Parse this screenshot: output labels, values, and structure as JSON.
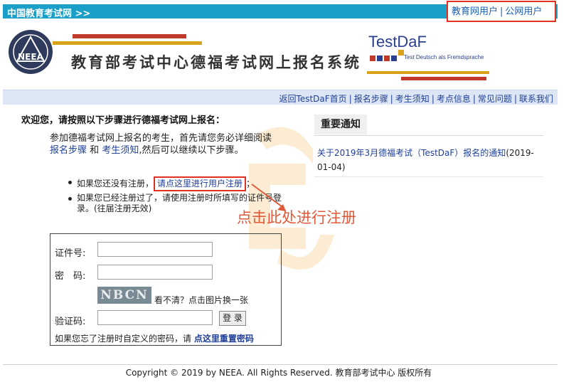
{
  "topbar": {
    "site_link": "中国教育考试网 >>",
    "user_link_edu": "教育网用户",
    "separator": "|",
    "user_link_public": "公网用户"
  },
  "header": {
    "logo_text": "NEEA",
    "system_title": "教育部考试中心德福考试网上报名系统",
    "testdaf_name": "TestDaF",
    "testdaf_tagline": "Test Deutsch als Fremdsprache"
  },
  "nav": {
    "items": [
      "返回TestDaF首页",
      "报名步骤",
      "考生须知",
      "考点信息",
      "常见问题",
      "联系我们"
    ],
    "separator": "|"
  },
  "main": {
    "welcome": "欢迎您，请按照以下步骤进行德福考试网上报名：",
    "intro_part1": "参加德福考试网上报名的考生，首先请您务必详细阅读",
    "intro_link1": "报名步骤",
    "intro_part2": "和",
    "intro_link2": "考生须知",
    "intro_part3": ",然后可以继续以下步骤。",
    "bullet1_prefix": "如果您还没有注册，",
    "bullet1_link": "请点这里进行用户注册",
    "bullet1_suffix": "；",
    "bullet2": "如果您已经注册过了，请使用注册时所填写的证件号登录。(往届注册无效)"
  },
  "login": {
    "id_label": "证件号:",
    "password_label": "密　码:",
    "captcha_text": "NBCN",
    "captcha_hint": "看不清？点击图片换一张",
    "code_label": "验证码:",
    "login_button": "登 录",
    "forgot_prefix": "如果您忘了注册时自定义的密码，请",
    "forgot_link": "点这里重置密码"
  },
  "notice": {
    "heading": "重要通知",
    "item_link": "关于2019年3月德福考试（TestDaF）报名的通知",
    "item_date": "(2019-01-04)"
  },
  "annotation": {
    "text": "点击此处进行注册"
  },
  "footer": {
    "copyright": "Copyright © 2019 by NEEA. All Rights Reserved. 教育部考试中心 版权所有"
  },
  "colors": {
    "topbar": "#1aa0c8",
    "highlight_border": "#e03020",
    "link": "#1f3f99",
    "navbar": "#dde6f4",
    "annotation": "#e05a3a"
  }
}
